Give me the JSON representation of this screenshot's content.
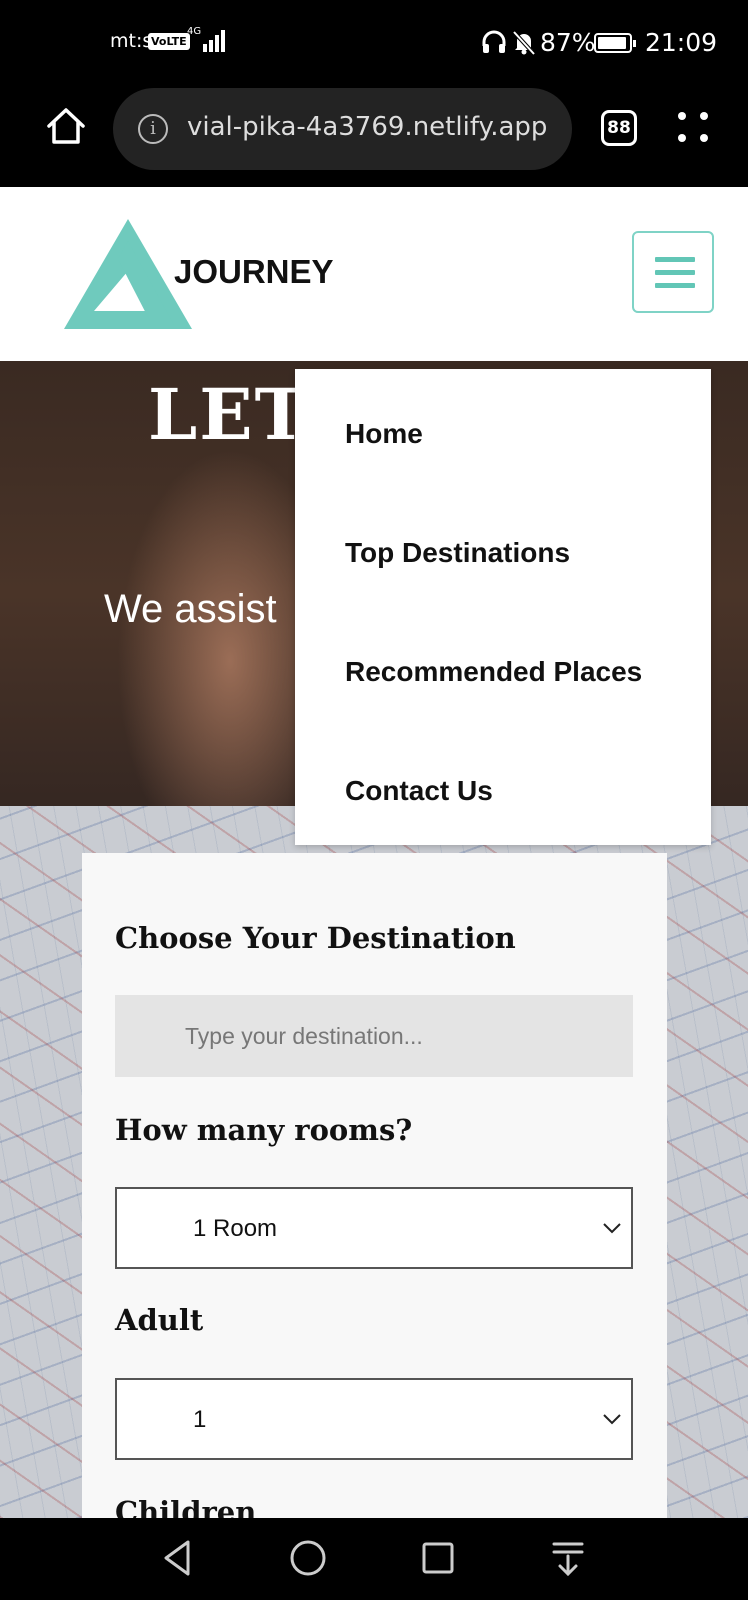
{
  "status_bar": {
    "carrier": "mt:s",
    "volte": "VoLTE",
    "network": "4G",
    "battery_percent": "87%",
    "time": "21:09"
  },
  "browser": {
    "url": "vial-pika-4a3769.netlify.app",
    "tab_count": "88",
    "icons": [
      "home-icon",
      "info-icon",
      "tabs-icon",
      "menu-icon"
    ]
  },
  "site": {
    "logo_text": "JOURNEY",
    "accent_color": "#62c6b6"
  },
  "hero": {
    "title": "LET",
    "subtitle": "We assist"
  },
  "nav_menu": {
    "items": [
      {
        "label": "Home"
      },
      {
        "label": "Top Destinations"
      },
      {
        "label": "Recommended Places"
      },
      {
        "label": "Contact Us"
      }
    ]
  },
  "form": {
    "destination_label": "Choose Your Destination",
    "destination_placeholder": "Type your destination...",
    "rooms_label": "How many rooms?",
    "rooms_value": "1 Room",
    "adult_label": "Adult",
    "adult_value": "1",
    "children_label": "Children"
  }
}
